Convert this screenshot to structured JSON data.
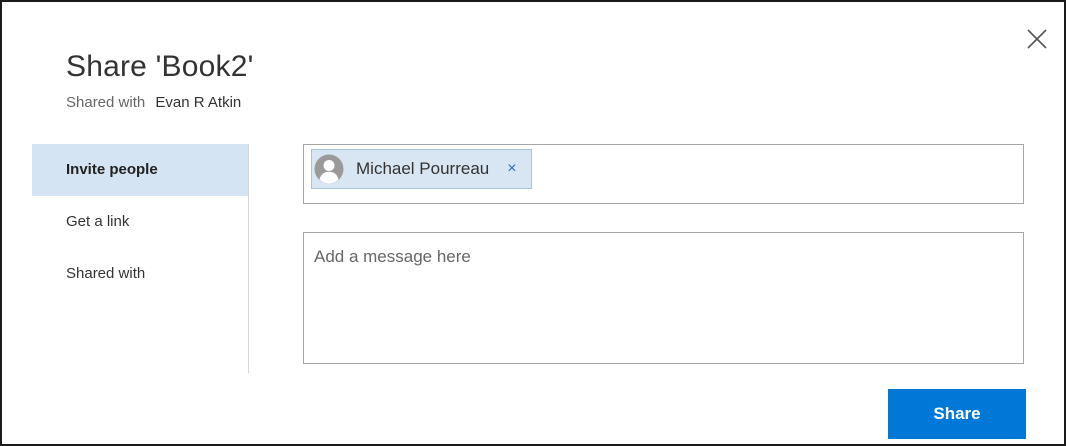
{
  "dialog": {
    "title": "Share 'Book2'",
    "shared_with_label": "Shared with",
    "shared_with_name": "Evan R Atkin",
    "close_icon": "close-icon"
  },
  "nav": {
    "items": [
      {
        "label": "Invite people",
        "selected": true
      },
      {
        "label": "Get a link",
        "selected": false
      },
      {
        "label": "Shared with",
        "selected": false
      }
    ]
  },
  "invite": {
    "recipients": [
      {
        "name": "Michael Pourreau",
        "remove_symbol": "×",
        "avatar_icon": "person-avatar-icon"
      }
    ],
    "message_placeholder": "Add a message here",
    "message_value": ""
  },
  "actions": {
    "share_label": "Share"
  },
  "colors": {
    "accent": "#0078d7",
    "selected_nav_bg": "#d5e4f3",
    "chip_bg": "#d8e6f3",
    "border": "#a6a6a6"
  }
}
